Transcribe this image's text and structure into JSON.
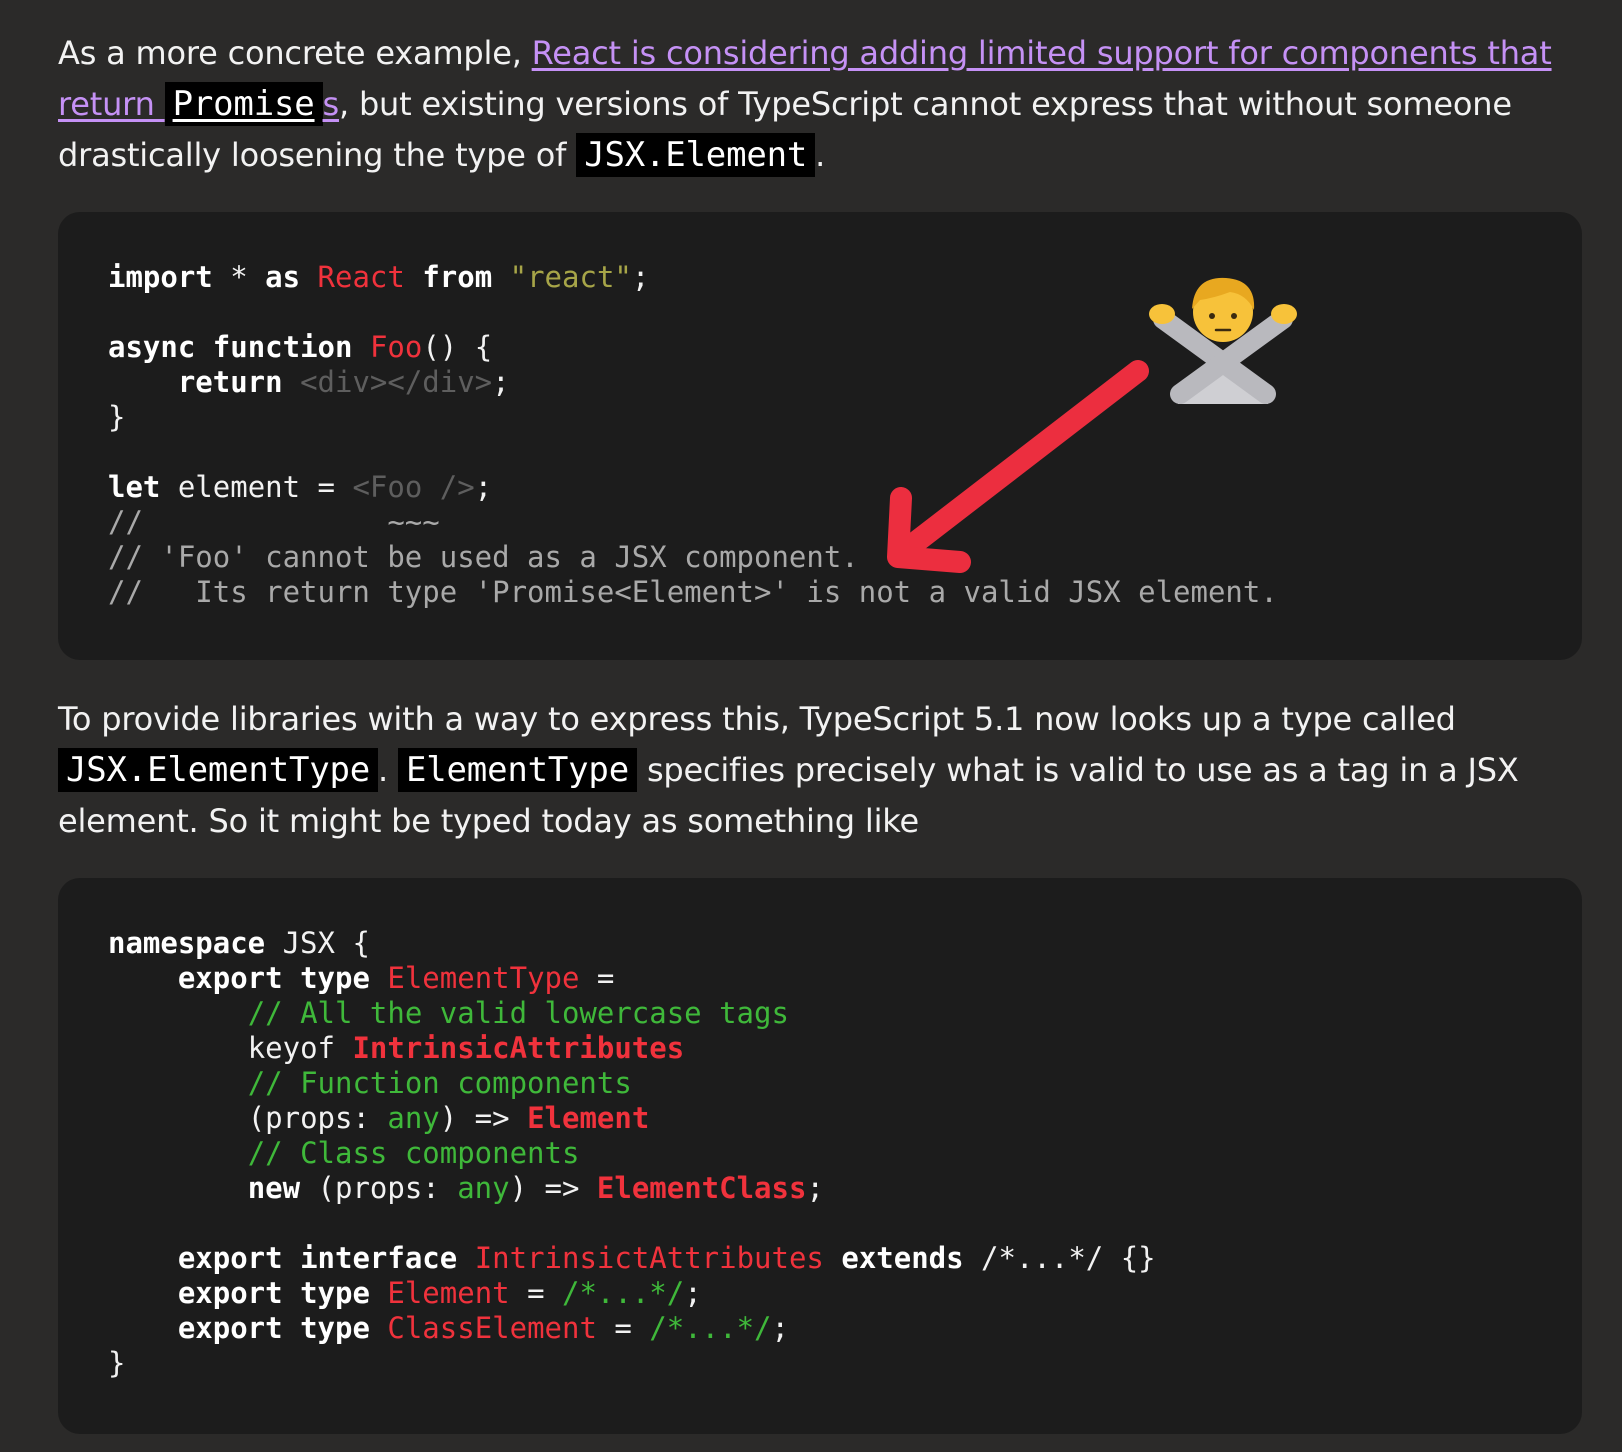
{
  "intro": {
    "before_link": "As a more concrete example, ",
    "link_text": "React is considering adding limited support for components that return ",
    "link_code": "Promise",
    "link_suffix": "s",
    "after_link": ", but existing versions of TypeScript cannot express that without someone drastically loosening the type of ",
    "code": "JSX.Element",
    "end": "."
  },
  "code1": {
    "l1_import": "import",
    "l1_star": " * ",
    "l1_as": "as",
    "l1_react": "React",
    "l1_from": "from",
    "l1_str": "\"react\"",
    "l1_semi": ";",
    "l3_async": "async",
    "l3_function": "function",
    "l3_foo": "Foo",
    "l3_rest": "() {",
    "l4_return": "return",
    "l4_jsx": "<div></div>",
    "l4_semi": ";",
    "l5": "}",
    "l7_let": "let",
    "l7_mid": " element = ",
    "l7_jsx": "<Foo />",
    "l7_semi": ";",
    "l8": "//              ~~~",
    "l9": "// 'Foo' cannot be used as a JSX component.",
    "l10": "//   Its return type 'Promise<Element>' is not a valid JSX element."
  },
  "annotation": {
    "emoji": "🙅",
    "arrow_color": "#ec2e3f",
    "arrow_icon": "arrow-pointing-to-error"
  },
  "para2": {
    "text1": "To provide libraries with a way to express this, TypeScript 5.1 now looks up a type called ",
    "code1": "JSX.ElementType",
    "text2": ". ",
    "code2": "ElementType",
    "text3": " specifies precisely what is valid to use as a tag in a JSX element. So it might be typed today as something like"
  },
  "code2": {
    "l1_namespace": "namespace",
    "l1_rest": " JSX {",
    "l2_export": "export",
    "l2_type": "type",
    "l2_name": "ElementType",
    "l2_eq": " =",
    "l3_comment": "// All the valid lowercase tags",
    "l4_keyof": "keyof ",
    "l4_name": "IntrinsicAttributes",
    "l5_comment": "// Function components",
    "l6_a": "(props: ",
    "l6_any": "any",
    "l6_b": ") => ",
    "l6_name": "Element",
    "l7_comment": "// Class components",
    "l8_new": "new",
    "l8_a": " (props: ",
    "l8_any": "any",
    "l8_b": ") => ",
    "l8_name": "ElementClass",
    "l8_semi": ";",
    "l10_export": "export",
    "l10_interface": "interface",
    "l10_name": "IntrinsictAttributes",
    "l10_extends": "extends",
    "l10_rest": " /*...*/ {}",
    "l11_export": "export",
    "l11_type": "type",
    "l11_name": "Element",
    "l11_eq": " = ",
    "l11_comment": "/*...*/",
    "l11_semi": ";",
    "l12_export": "export",
    "l12_type": "type",
    "l12_name": "ClassElement",
    "l12_eq": " = ",
    "l12_comment": "/*...*/",
    "l12_semi": ";",
    "l13": "}"
  }
}
